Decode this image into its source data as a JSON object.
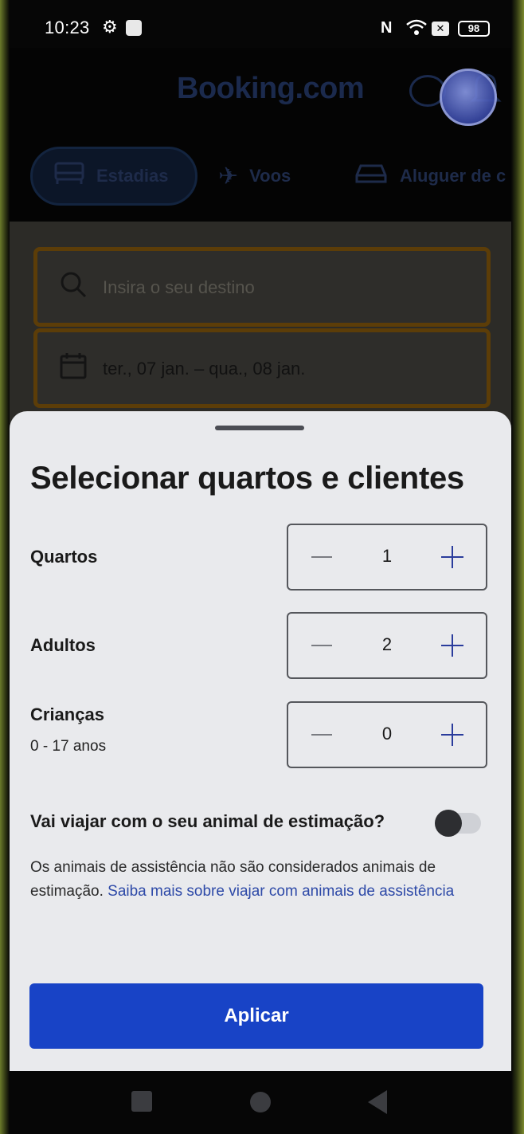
{
  "status_bar": {
    "time": "10:23",
    "battery": "98",
    "icons": [
      "gear-icon",
      "message-icon",
      "nfc-icon",
      "wifi-icon",
      "close-box-icon",
      "battery-icon"
    ]
  },
  "header": {
    "brand": "Booking.com",
    "icons": [
      "chat-icon",
      "bell-icon"
    ]
  },
  "tabs": [
    {
      "label": "Estadias",
      "icon": "bed-icon",
      "selected": true
    },
    {
      "label": "Voos",
      "icon": "plane-icon",
      "selected": false
    },
    {
      "label": "Aluguer de c",
      "icon": "car-icon",
      "selected": false
    }
  ],
  "search": {
    "destination_placeholder": "Insira o seu destino",
    "dates": "ter., 07 jan. – qua., 08 jan."
  },
  "sheet": {
    "title": "Selecionar quartos e clientes",
    "rows": [
      {
        "label": "Quartos",
        "value": "1"
      },
      {
        "label": "Adultos",
        "value": "2"
      },
      {
        "label": "Crianças",
        "sub": "0 - 17 anos",
        "value": "0"
      }
    ],
    "minus_symbol": "—",
    "plus_symbol": "+",
    "pet_question": "Vai viajar com o seu animal de estimação?",
    "pet_toggle_on": false,
    "pet_note": "Os animais de assistência não são considerados animais de estimação.",
    "pet_link": "Saiba mais sobre viajar com animais de assistência",
    "apply_label": "Aplicar"
  },
  "colors": {
    "accent": "#1843c6",
    "link": "#2e4aa8",
    "sheet_bg": "#e9eaed"
  }
}
